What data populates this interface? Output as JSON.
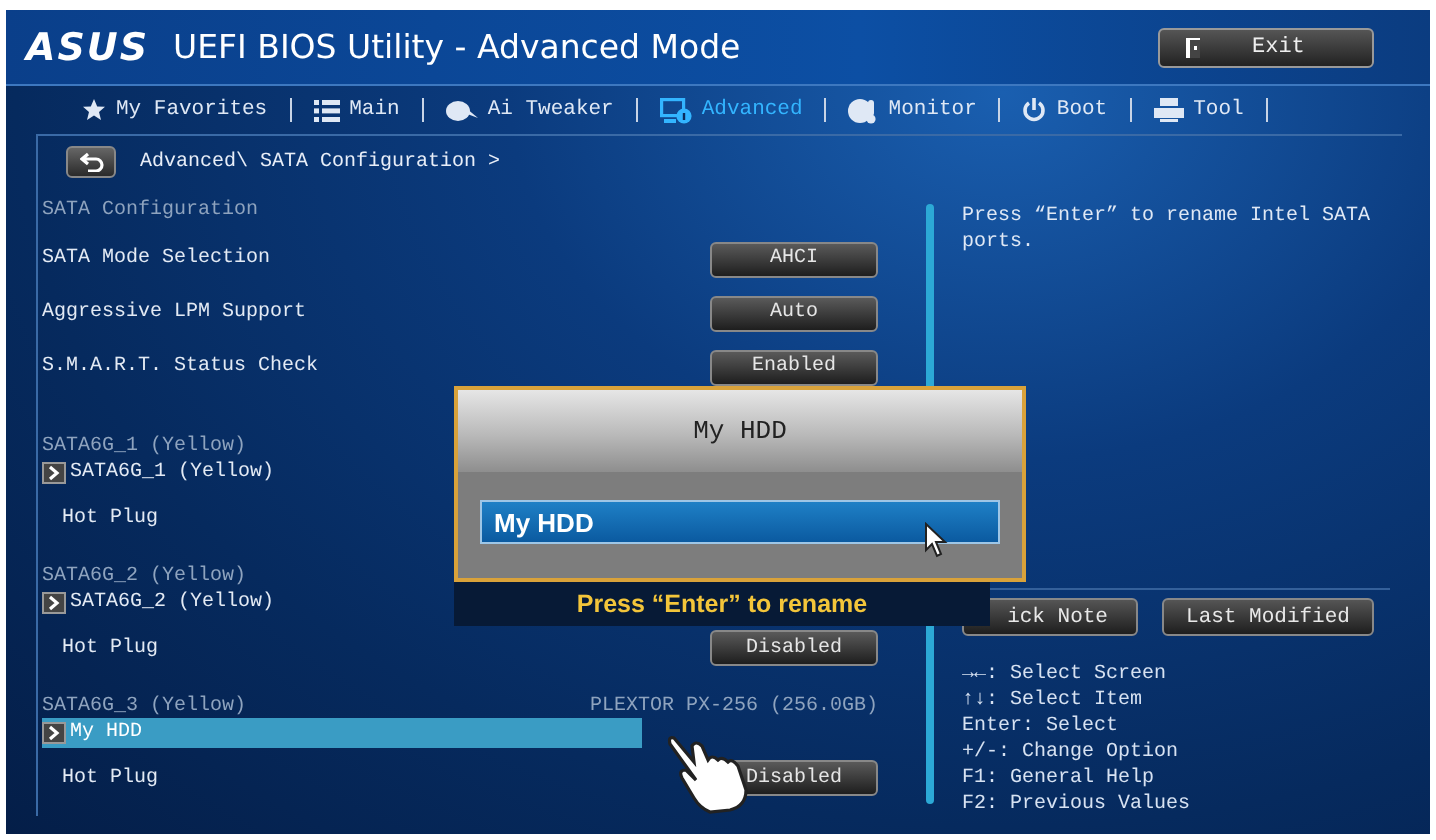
{
  "window": {
    "logo": "ASUS",
    "title": "UEFI BIOS Utility - Advanced Mode"
  },
  "exit_button": "Exit",
  "tabs": [
    {
      "label": "My Favorites",
      "selected": false
    },
    {
      "label": "Main",
      "selected": false
    },
    {
      "label": "Ai Tweaker",
      "selected": false
    },
    {
      "label": "Advanced",
      "selected": true
    },
    {
      "label": "Monitor",
      "selected": false
    },
    {
      "label": "Boot",
      "selected": false
    },
    {
      "label": "Tool",
      "selected": false
    }
  ],
  "breadcrumb": "Advanced\\ SATA Configuration >",
  "settings": [
    {
      "kind": "section",
      "label": "SATA Configuration"
    },
    {
      "kind": "option",
      "label": "SATA Mode Selection",
      "value": "AHCI"
    },
    {
      "kind": "option",
      "label": "Aggressive LPM Support",
      "value": "Auto"
    },
    {
      "kind": "option",
      "label": "S.M.A.R.T. Status Check",
      "value": "Enabled"
    },
    {
      "kind": "port",
      "label": "SATA6G_1 (Yellow)",
      "link": "SATA6G_1 (Yellow)",
      "selected": false
    },
    {
      "kind": "sub_option",
      "label": "Hot Plug"
    },
    {
      "kind": "port",
      "label": "SATA6G_2 (Yellow)",
      "link": "SATA6G_2 (Yellow)",
      "selected": false
    },
    {
      "kind": "sub_option",
      "label": "Hot Plug",
      "value": "Disabled"
    },
    {
      "kind": "port",
      "label": "SATA6G_3 (Yellow)",
      "device": "PLEXTOR PX-256 (256.0GB)",
      "link": "My HDD",
      "selected": true
    },
    {
      "kind": "sub_option",
      "label": "Hot Plug",
      "value": "Disabled"
    }
  ],
  "help_text": "Press “Enter” to rename Intel SATA ports.",
  "side_buttons": [
    "ick Note",
    "Last Modified"
  ],
  "key_hints": [
    "→←: Select Screen",
    "↑↓: Select Item",
    "Enter: Select",
    "+/-: Change Option",
    "F1: General Help",
    "F2: Previous Values"
  ],
  "dialog": {
    "title": "My HDD",
    "value": "My HDD",
    "hint": "Press “Enter” to rename"
  }
}
